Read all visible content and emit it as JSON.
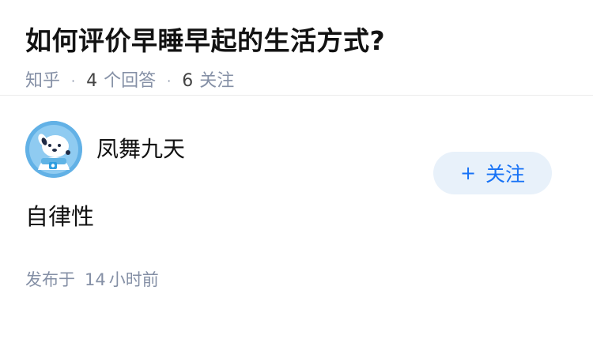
{
  "question": {
    "title": "如何评价早睡早起的生活方式?",
    "source": "知乎",
    "answer_count": "4",
    "answer_label": "个回答",
    "follower_count": "6",
    "follower_label": "关注"
  },
  "answer": {
    "author_name": "凤舞九天",
    "follow_plus": "+",
    "follow_label": "关注",
    "content": "自律性",
    "published_prefix": "发布于",
    "published_num": "14",
    "published_unit": "小时前"
  },
  "colors": {
    "accent": "#1772f6",
    "meta": "#8590a6",
    "follow_bg": "#e8f1fa",
    "avatar_bg": "#6bb6e8"
  }
}
